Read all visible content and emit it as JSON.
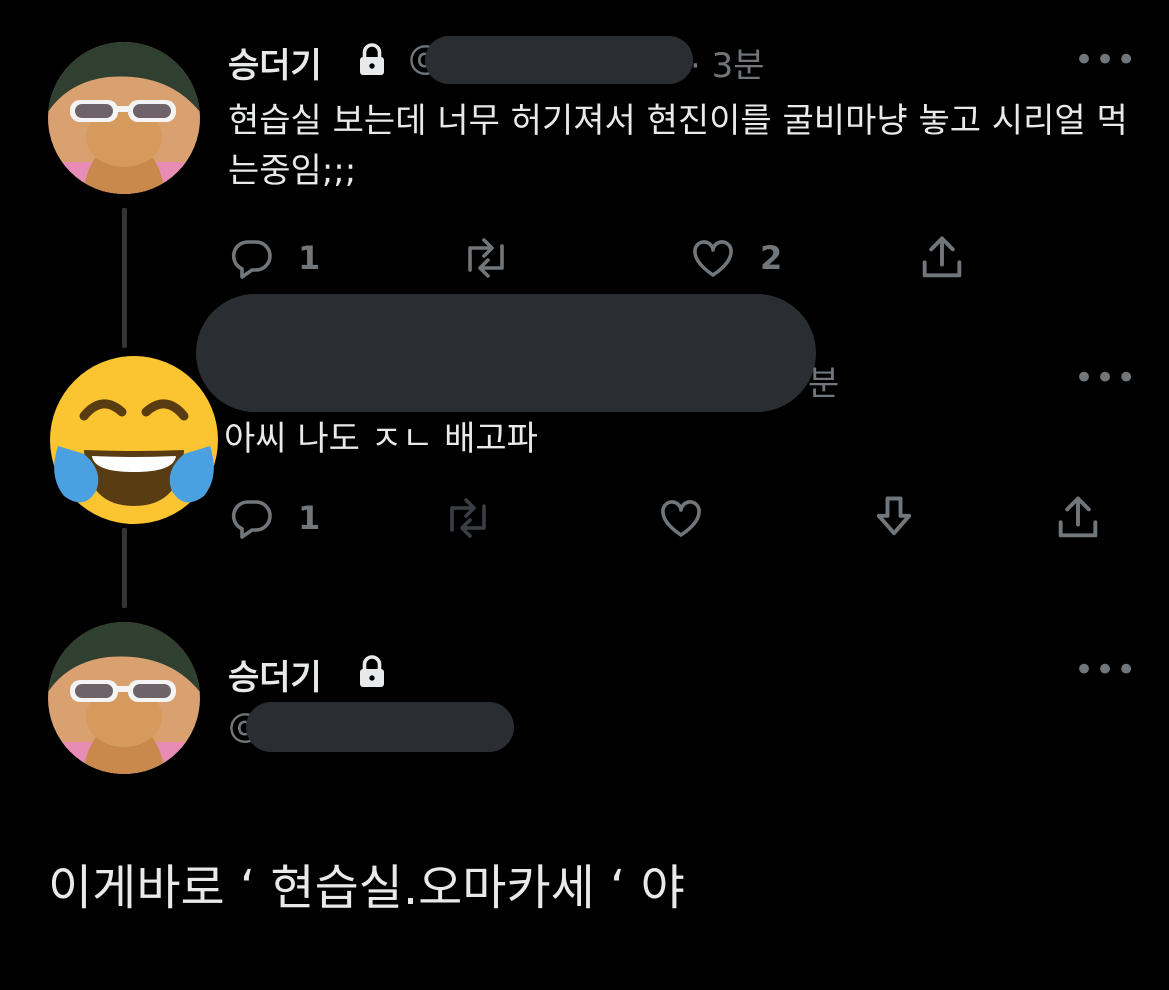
{
  "tweet1": {
    "display_name": "승더기",
    "handle_prefix": "@",
    "time": "· 3분",
    "text": "현습실 보는데 너무 허기져서 현진이를 굴비마냥 놓고 시리얼 먹는중임;;;",
    "reply_count": "1",
    "like_count": "2",
    "more": "•••"
  },
  "tweet2": {
    "time_suffix": "분",
    "text": "아씨 나도 ㅈㄴ 배고파",
    "reply_count": "1",
    "more": "•••",
    "avatar_emoji": "😂"
  },
  "tweet3": {
    "display_name": "승더기",
    "handle_prefix": "@",
    "text": "이게바로 ‘ 현습실.오마카세 ‘ 야",
    "more": "•••"
  },
  "icons": {
    "lock": "lock-icon",
    "reply": "reply-icon",
    "retweet": "retweet-icon",
    "like": "like-icon",
    "share": "share-icon",
    "download": "download-icon"
  },
  "colors": {
    "background": "#000000",
    "text": "#e7e9ea",
    "muted": "#71767b",
    "redaction": "#2a2e33"
  }
}
